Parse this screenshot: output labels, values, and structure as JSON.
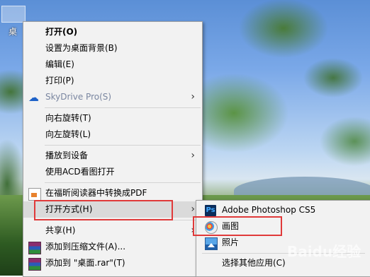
{
  "desktop": {
    "icon_label": "桌"
  },
  "context_menu": {
    "items": [
      {
        "label": "打开(O)"
      },
      {
        "label": "设置为桌面背景(B)"
      },
      {
        "label": "编辑(E)"
      },
      {
        "label": "打印(P)"
      },
      {
        "label": "SkyDrive Pro(S)",
        "icon": "cloud-icon"
      },
      {
        "label": "向右旋转(T)"
      },
      {
        "label": "向左旋转(L)"
      },
      {
        "label": "播放到设备"
      },
      {
        "label": "使用ACD看图打开"
      },
      {
        "label": "在福昕阅读器中转换成PDF",
        "icon": "pdf-icon"
      },
      {
        "label": "打开方式(H)"
      },
      {
        "label": "共享(H)"
      },
      {
        "label": "添加到压缩文件(A)...",
        "icon": "rar-icon"
      },
      {
        "label": "添加到 \"桌面.rar\"(T)",
        "icon": "rar-icon"
      }
    ],
    "submenu_arrow": "›"
  },
  "open_with_submenu": {
    "items": [
      {
        "label": "Adobe Photoshop CS5",
        "icon": "photoshop-icon"
      },
      {
        "label": "画图",
        "icon": "paint-icon"
      },
      {
        "label": "照片",
        "icon": "photos-icon"
      },
      {
        "label": "选择其他应用(C)"
      }
    ]
  },
  "watermark": "Baidu经验",
  "colors": {
    "highlight_box": "#e03a3a",
    "menu_bg": "#f2f2f2",
    "hover_bg": "#dadada"
  }
}
